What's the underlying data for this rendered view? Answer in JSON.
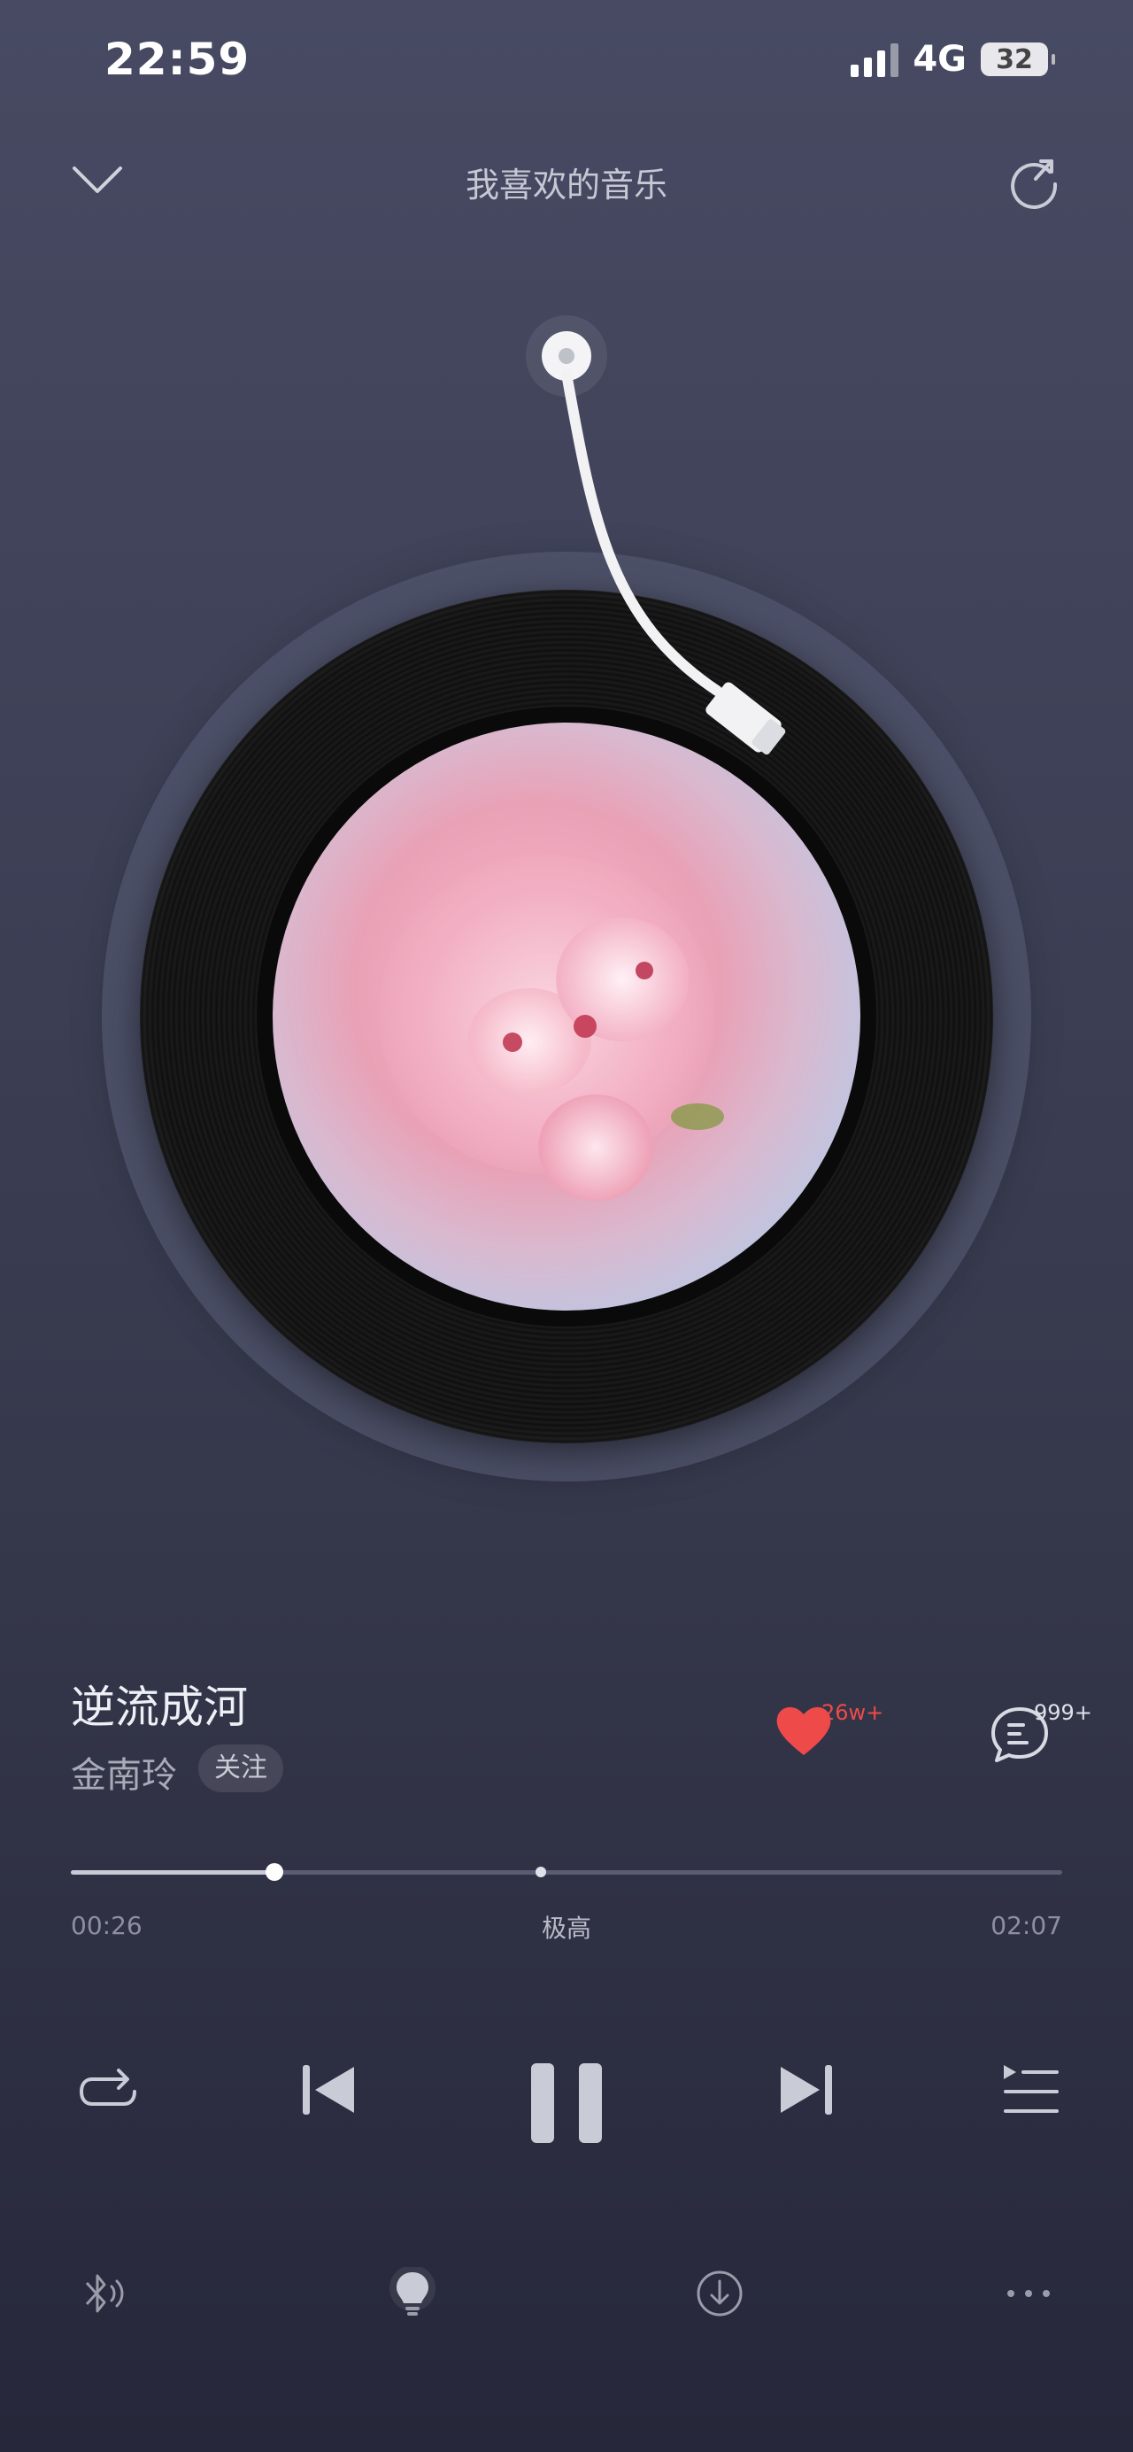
{
  "status_bar": {
    "time": "22:59",
    "network": "4G",
    "battery": "32"
  },
  "header": {
    "title": "我喜欢的音乐",
    "back_icon": "chevron-down-icon",
    "share_icon": "share-icon"
  },
  "song": {
    "title": "逆流成河",
    "artist": "金南玲",
    "follow_label": "关注"
  },
  "actions": {
    "like_count": "26w+",
    "comment_count": "999+",
    "like_color": "#ef4a4a"
  },
  "progress": {
    "current": "00:26",
    "total": "02:07",
    "quality": "极高",
    "fraction": 0.205
  },
  "controls": {
    "mode_icon": "repeat-icon",
    "prev_icon": "previous-icon",
    "play_state_icon": "pause-icon",
    "next_icon": "next-icon",
    "playlist_icon": "playlist-icon"
  },
  "bottom_bar": [
    "bluetooth-sound-icon",
    "lightbulb-icon",
    "download-icon",
    "more-icon"
  ]
}
